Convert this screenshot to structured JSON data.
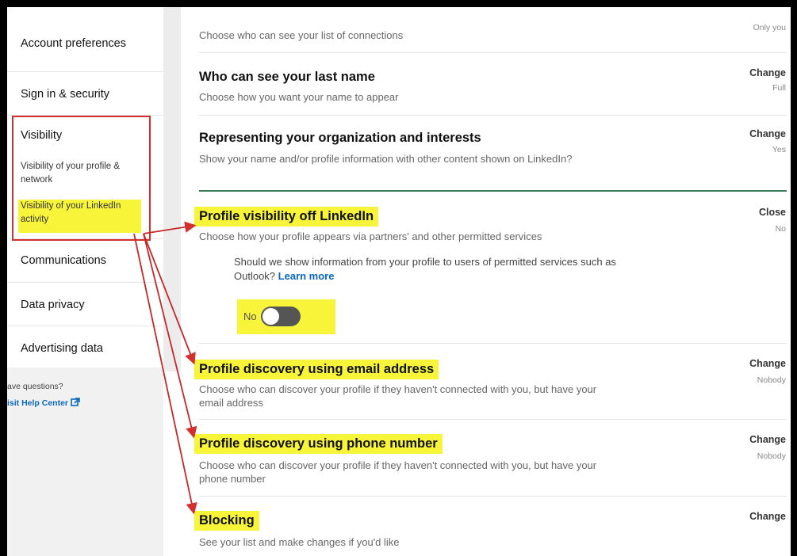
{
  "sidebar": {
    "items": [
      {
        "label": "Account preferences"
      },
      {
        "label": "Sign in & security"
      },
      {
        "label": "Visibility"
      },
      {
        "label": "Communications"
      },
      {
        "label": "Data privacy"
      },
      {
        "label": "Advertising data"
      }
    ],
    "visibility_subitems": [
      {
        "label": "Visibility of your profile & network"
      },
      {
        "label": "Visibility of your LinkedIn activity"
      }
    ],
    "help_question": "ave questions?",
    "help_link": "isit Help Center"
  },
  "main": {
    "connections": {
      "desc": "Choose who can see your list of connections",
      "value": "Only you"
    },
    "last_name": {
      "title": "Who can see your last name",
      "desc": "Choose how you want your name to appear",
      "action": "Change",
      "value": "Full"
    },
    "representing": {
      "title": "Representing your organization and interests",
      "desc": "Show your name and/or profile information with other content shown on LinkedIn?",
      "action": "Change",
      "value": "Yes"
    },
    "off_linkedin": {
      "title": "Profile visibility off LinkedIn",
      "desc": "Choose how your profile appears via partners' and other permitted services",
      "action": "Close",
      "value": "No",
      "question": "Should we show information from your profile to users of permitted services such as Outlook?",
      "learn_more": "Learn more",
      "toggle_label": "No"
    },
    "email_discovery": {
      "title": "Profile discovery using email address",
      "desc": "Choose who can discover your profile if they haven't connected with you, but have your email address",
      "action": "Change",
      "value": "Nobody"
    },
    "phone_discovery": {
      "title": "Profile discovery using phone number",
      "desc": "Choose who can discover your profile if they haven't connected with you, but have your phone number",
      "action": "Change",
      "value": "Nobody"
    },
    "blocking": {
      "title": "Blocking",
      "desc": "See your list and make changes if you'd like",
      "action": "Change"
    }
  },
  "colors": {
    "highlight": "#f7f43a",
    "annotation_red": "#d32f2f",
    "link": "#0a66c2",
    "active_divider": "#3a7d5c"
  }
}
